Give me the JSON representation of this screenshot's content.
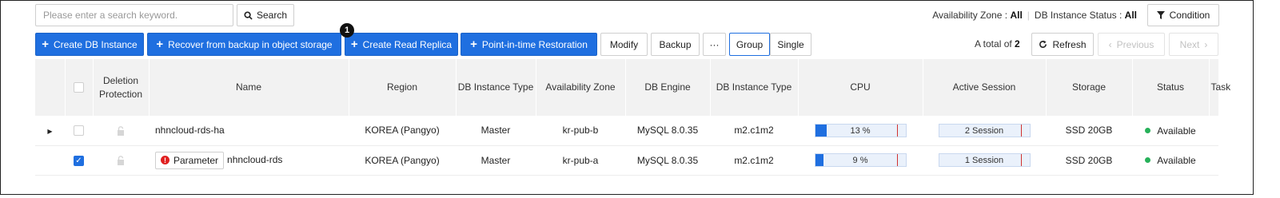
{
  "search": {
    "placeholder": "Please enter a search keyword.",
    "button_label": "Search"
  },
  "filters": {
    "availability_zone_label": "Availability Zone",
    "availability_zone_value": "All",
    "status_label": "DB Instance Status",
    "status_value": "All",
    "condition_label": "Condition"
  },
  "toolbar": {
    "create_label": "Create DB Instance",
    "recover_label": "Recover from backup in object storage",
    "replica_label": "Create Read Replica",
    "pitr_label": "Point-in-time Restoration",
    "modify_label": "Modify",
    "backup_label": "Backup",
    "more_label": "···",
    "group_label": "Group",
    "single_label": "Single",
    "badge_number": "1"
  },
  "pagination": {
    "total_prefix": "A total of",
    "total_count": "2",
    "refresh_label": "Refresh",
    "previous_label": "Previous",
    "next_label": "Next"
  },
  "table": {
    "headers": {
      "deletion_protection": "Deletion Protection",
      "name": "Name",
      "region": "Region",
      "instance_type": "DB Instance Type",
      "availability_zone": "Availability Zone",
      "db_engine": "DB Engine",
      "db_instance_type2": "DB Instance Type",
      "cpu": "CPU",
      "active_session": "Active Session",
      "storage": "Storage",
      "status": "Status",
      "task": "Task"
    },
    "rows": [
      {
        "name": "nhncloud-rds-ha",
        "region": "KOREA (Pangyo)",
        "type": "Master",
        "zone": "kr-pub-b",
        "engine": "MySQL 8.0.35",
        "flavor": "m2.c1m2",
        "cpu_label": "13 %",
        "cpu_pct": 13,
        "session_label": "2 Session",
        "session_pct": 0,
        "storage": "SSD 20GB",
        "status": "Available",
        "task": "",
        "checked": false
      },
      {
        "name": "nhncloud-rds",
        "parameter_label": "Parameter",
        "region": "KOREA (Pangyo)",
        "type": "Master",
        "zone": "kr-pub-a",
        "engine": "MySQL 8.0.35",
        "flavor": "m2.c1m2",
        "cpu_label": "9 %",
        "cpu_pct": 9,
        "session_label": "1 Session",
        "session_pct": 0,
        "storage": "SSD 20GB",
        "status": "Available",
        "task": "",
        "checked": true
      }
    ]
  },
  "colors": {
    "primary": "#1f6fe0",
    "available": "#27b15a",
    "limit_marker": "#d03030",
    "warning": "#e02020"
  }
}
